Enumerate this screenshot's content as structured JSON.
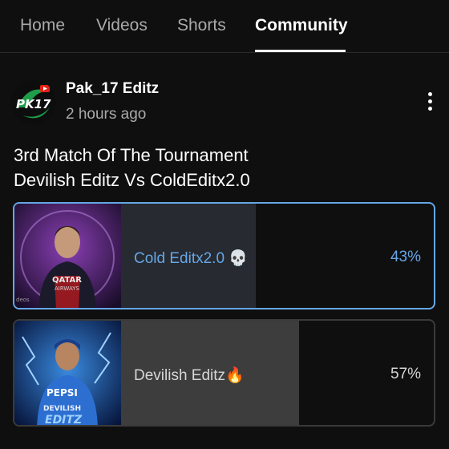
{
  "tabs": [
    {
      "label": "Home",
      "active": false
    },
    {
      "label": "Videos",
      "active": false
    },
    {
      "label": "Shorts",
      "active": false
    },
    {
      "label": "Community",
      "active": true
    }
  ],
  "post": {
    "channel": {
      "name": "Pak_17 Editz",
      "avatar_text": "PK17"
    },
    "time": "2 hours ago",
    "text_lines": [
      "3rd Match Of The Tournament",
      "Devilish Editz Vs ColdEditx2.0"
    ],
    "poll": {
      "options": [
        {
          "label": "Cold Editx2.0 💀",
          "percent": "43%",
          "share": 0.43,
          "selected": true,
          "thumb_text": "QATAR AIRWAYS"
        },
        {
          "label": "Devilish Editz🔥",
          "percent": "57%",
          "share": 0.57,
          "selected": false,
          "thumb_text": "DEVILISH EDITZ"
        }
      ]
    }
  },
  "colors": {
    "background": "#0f0f0f",
    "accent_blue": "#65a7e7",
    "muted_text": "#aaaaaa"
  },
  "icons": {
    "menu": "more-vertical-icon"
  }
}
